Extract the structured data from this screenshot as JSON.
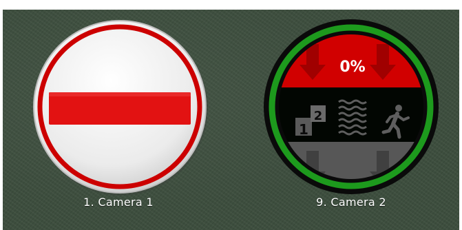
{
  "cameras": [
    {
      "label": "1. Camera 1",
      "state": "disabled",
      "icon": "no-entry-icon",
      "colors": {
        "ring": "#cc0000",
        "bar": "#e21212",
        "face": "#f2f2f2"
      }
    },
    {
      "label": "9. Camera 2",
      "state": "active",
      "percent_text": "0%",
      "icons": [
        "counter-icon",
        "noise-icon",
        "running-person-icon"
      ],
      "colors": {
        "ring": "#1d9a1d",
        "top": "#d10000",
        "middle": "#000000",
        "bottom": "#555555"
      }
    }
  ]
}
